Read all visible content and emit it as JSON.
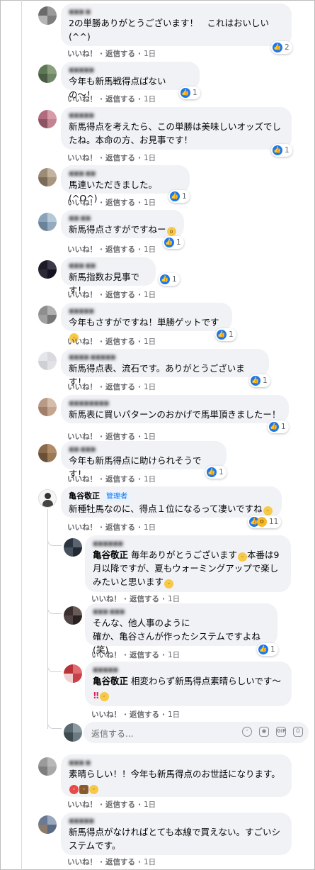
{
  "actions": {
    "like": "いいね！",
    "reply": "返信する",
    "time": "1日"
  },
  "admin_badge": "管理者",
  "reply_placeholder": "返信する...",
  "reply_tools": [
    "emoji-icon",
    "camera-icon",
    "gif-icon",
    "sticker-icon"
  ],
  "colors": {
    "like_blue": "#1877f2",
    "bubble_bg": "#f0f2f5",
    "meta_gray": "#65676b"
  },
  "comments": [
    {
      "name": "■■■ ■",
      "lines": [
        "2の単勝ありがとうございます！　これはおいしい",
        "(^^)"
      ],
      "reactions": {
        "icons": [
          "like-icon"
        ],
        "count": "2"
      }
    },
    {
      "name": "■■■■■",
      "lines": [
        "今年も新馬戦得点ぱないの〜！"
      ],
      "reactions": {
        "icons": [
          "like-icon"
        ],
        "count": "1"
      }
    },
    {
      "name": "■■■■■",
      "lines": [
        "新馬得点を考えたら、この単勝は美味しいオッズでし",
        "たね。本命の方、お見事です！"
      ],
      "reactions": {
        "icons": [
          "like-icon"
        ],
        "count": "1"
      }
    },
    {
      "name": "■■■ ■■",
      "lines": [
        "馬連いただきました。(^O^)"
      ],
      "reactions": {
        "icons": [
          "like-icon"
        ],
        "count": "1"
      }
    },
    {
      "name": "■■ ■■",
      "lines": [
        "新馬得点さすがですねー"
      ],
      "emoji": [
        "wow-emoji"
      ],
      "reactions": {
        "icons": [
          "like-icon"
        ],
        "count": "1"
      }
    },
    {
      "name": "■■■ ■■",
      "lines": [
        "新馬指数お見事です！"
      ],
      "reactions": {
        "icons": [
          "like-icon"
        ],
        "count": "1"
      }
    },
    {
      "name": "■■■■■",
      "lines": [
        "今年もさすがですね！単勝ゲットです"
      ],
      "emoji": [
        "grin-emoji"
      ],
      "reactions": {
        "icons": [
          "like-icon"
        ],
        "count": "1"
      }
    },
    {
      "name": "■■■■ ■■■■■",
      "lines": [
        "新馬得点表、流石です。ありがとうございます！"
      ],
      "reactions": {
        "icons": [
          "like-icon"
        ],
        "count": "1"
      }
    },
    {
      "name": "■■■■■■■■",
      "lines": [
        "新馬表に買いパターンのおかげで馬単頂きましたー！"
      ],
      "reactions": {
        "icons": [
          "like-icon"
        ],
        "count": "1"
      }
    },
    {
      "name": "■■ ■■■",
      "lines": [
        "今年も新馬得点に助けられそうです！"
      ],
      "reactions": {
        "icons": [
          "like-icon"
        ],
        "count": "1"
      }
    },
    {
      "name": "亀谷敬正",
      "admin": true,
      "lines": [
        "新種牡馬なのに、得点１位になるって凄いですね"
      ],
      "emoji": [
        "grin-emoji"
      ],
      "reactions": {
        "icons": [
          "like-icon",
          "wow-icon"
        ],
        "count": "11"
      }
    }
  ],
  "replies": [
    {
      "name": "■■■■■■",
      "mention": "亀谷敬正",
      "lines": [
        " 毎年ありがとうございます",
        "本番は9",
        "月以降ですが、夏もウォーミングアップで楽し",
        "みたいと思います"
      ]
    },
    {
      "name": "■■■ ■■■",
      "lines": [
        "そんな、他人事のように",
        "確か、亀谷さんが作ったシステムですよね(笑)"
      ],
      "reactions": {
        "icons": [
          "like-icon"
        ],
        "count": "1"
      }
    },
    {
      "name": "■■■■■",
      "mention": "亀谷敬正",
      "lines": [
        " 相変わらず新馬得点素晴らしいです〜"
      ]
    }
  ],
  "bottom_comments": [
    {
      "name": "■■■ ■",
      "lines": [
        "素晴らしい！！今年も新馬得点のお世話になります。"
      ]
    },
    {
      "name": "■■■■■",
      "lines": [
        "新馬得点がなければとても本線で買えない。すごいシ",
        "ステムです。"
      ]
    }
  ]
}
